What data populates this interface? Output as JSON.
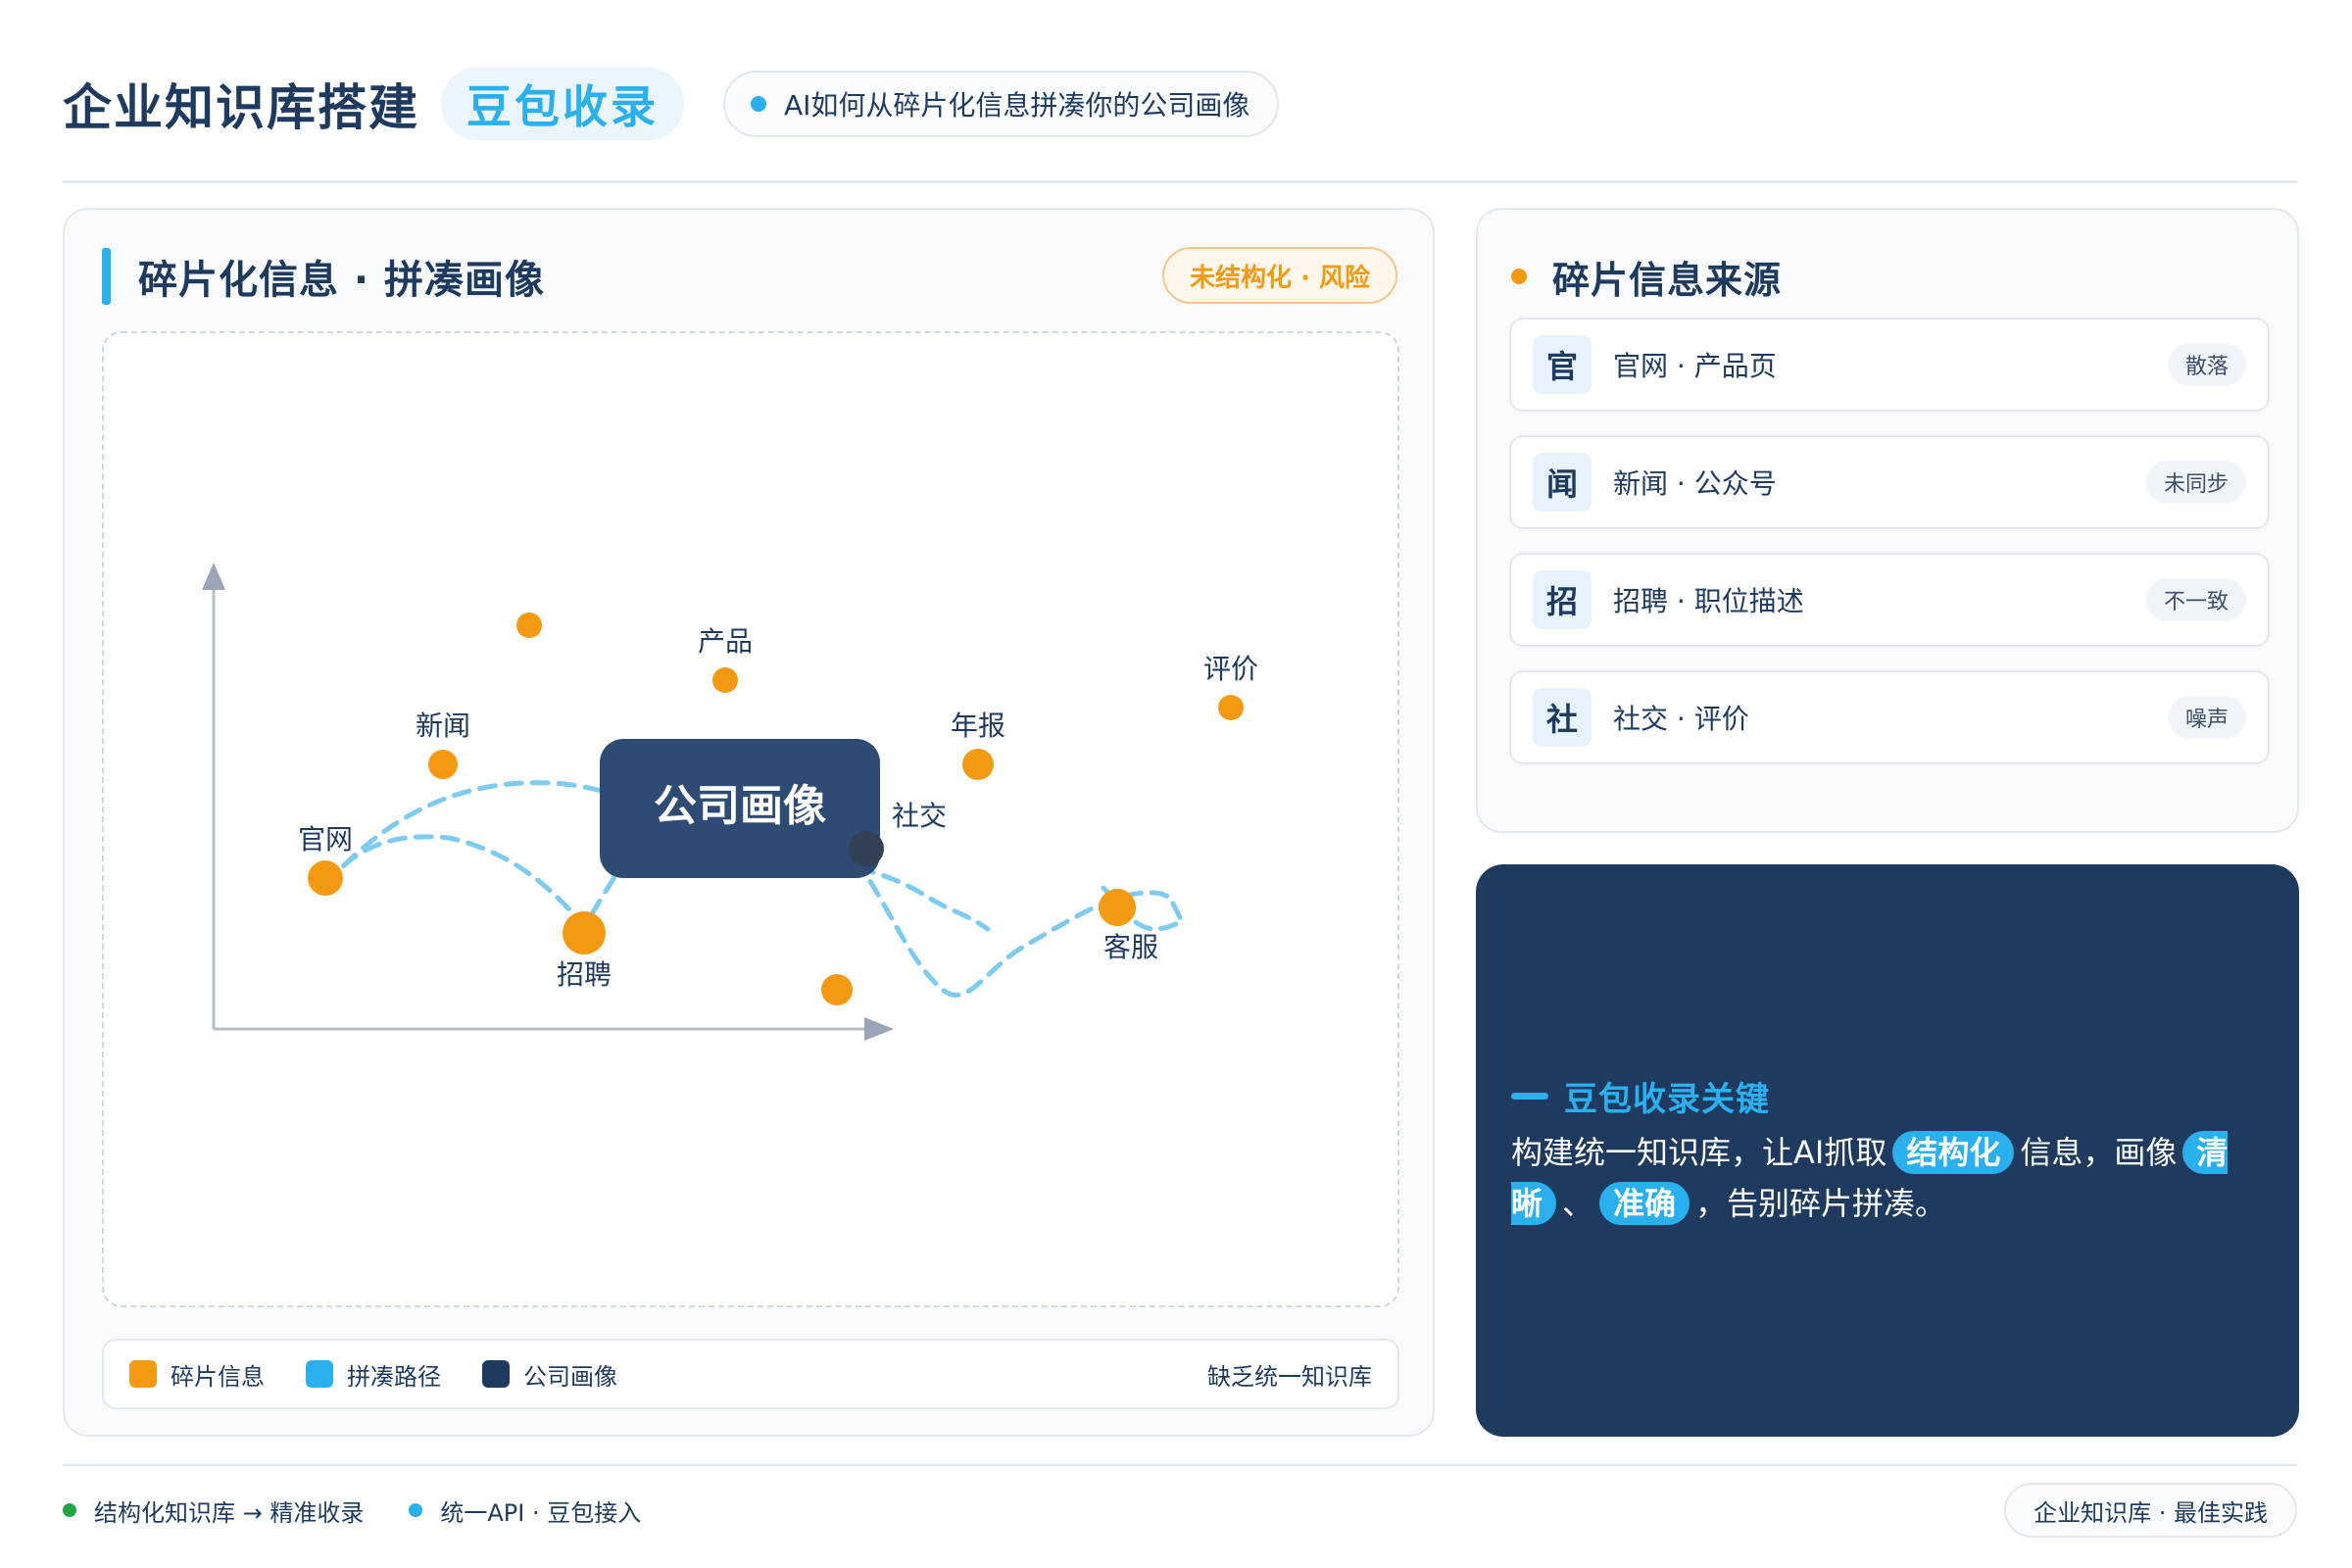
{
  "header": {
    "title": "企业知识库搭建",
    "badge": "豆包收录",
    "subtitle": "AI如何从碎片化信息拼凑你的公司画像"
  },
  "left_panel": {
    "title": "碎片化信息 · 拼凑画像",
    "badge": "未结构化 · 风险",
    "diagram": {
      "center_label": "公司画像",
      "nodes": [
        {
          "id": "guanwang",
          "label": "官网"
        },
        {
          "id": "xinwen",
          "label": "新闻"
        },
        {
          "id": "unlabeled-top",
          "label": ""
        },
        {
          "id": "chanpin",
          "label": "产品"
        },
        {
          "id": "zhaopin",
          "label": "招聘"
        },
        {
          "id": "unlabeled-bottom",
          "label": ""
        },
        {
          "id": "nianbao",
          "label": "年报"
        },
        {
          "id": "shejiao",
          "label": "社交"
        },
        {
          "id": "kefu",
          "label": "客服"
        },
        {
          "id": "pingjia",
          "label": "评价"
        }
      ]
    },
    "legend": [
      {
        "label": "碎片信息",
        "color": "#f39a12"
      },
      {
        "label": "拼凑路径",
        "color": "#2ab0ee"
      },
      {
        "label": "公司画像",
        "color": "#1e3a5f"
      }
    ],
    "legend_note": "缺乏统一知识库"
  },
  "sources": {
    "title": "碎片信息来源",
    "items": [
      {
        "icon": "官",
        "label": "官网 · 产品页",
        "tag": "散落"
      },
      {
        "icon": "闻",
        "label": "新闻 · 公众号",
        "tag": "未同步"
      },
      {
        "icon": "招",
        "label": "招聘 · 职位描述",
        "tag": "不一致"
      },
      {
        "icon": "社",
        "label": "社交 · 评价",
        "tag": "噪声"
      }
    ]
  },
  "key_card": {
    "title": "豆包收录关键",
    "text_1": "构建统一知识库，让AI抓取",
    "highlight_1": "结构化",
    "text_2": "信息，画像",
    "highlight_2": "清晰",
    "text_3": "、",
    "highlight_3": "准确",
    "text_4": "，告别碎片拼凑。"
  },
  "footer": {
    "item_1": "结构化知识库 → 精准收录",
    "item_2": "统一API · 豆包接入",
    "pill": "企业知识库 · 最佳实践"
  },
  "colors": {
    "primary": "#1e3a5f",
    "accent": "#2ab0ee",
    "fragment": "#f39a12",
    "success": "#22a447"
  }
}
